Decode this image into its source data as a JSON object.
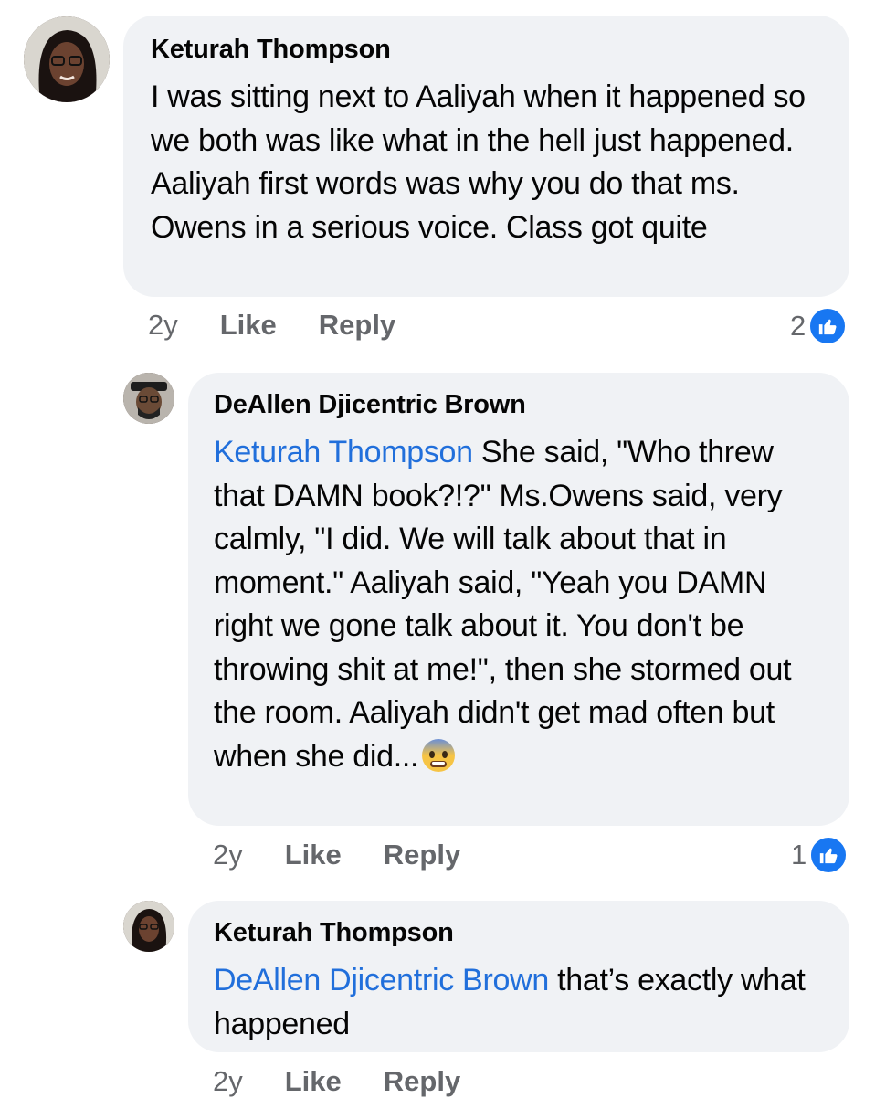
{
  "comments": [
    {
      "author": "Keturah Thompson",
      "text": "I was sitting next to Aaliyah when it happened so we both was like what in the hell just happened. Aaliyah first words was why you do that ms. Owens in a serious voice. Class got quite",
      "time": "2y",
      "like_label": "Like",
      "reply_label": "Reply",
      "reaction_count": "2"
    },
    {
      "author": "DeAllen Djicentric Brown",
      "mention": "Keturah Thompson",
      "text": " She said, \"Who threw that DAMN book?!?\" Ms.Owens said, very calmly, \"I did. We will talk about that in moment.\" Aaliyah said, \"Yeah you DAMN right we gone talk about it. You don't be throwing shit at me!\", then she stormed out the room. Aaliyah didn't get mad often but when she did...",
      "emoji": "anxious-face-emoji",
      "time": "2y",
      "like_label": "Like",
      "reply_label": "Reply",
      "reaction_count": "1"
    },
    {
      "author": "Keturah Thompson",
      "mention": "DeAllen Djicentric Brown",
      "text": " that’s exactly what happened",
      "time": "2y",
      "like_label": "Like",
      "reply_label": "Reply"
    }
  ],
  "colors": {
    "bubble": "#f0f2f5",
    "mention": "#216fdb",
    "meta": "#65676b",
    "like_badge": "#1877f2"
  }
}
